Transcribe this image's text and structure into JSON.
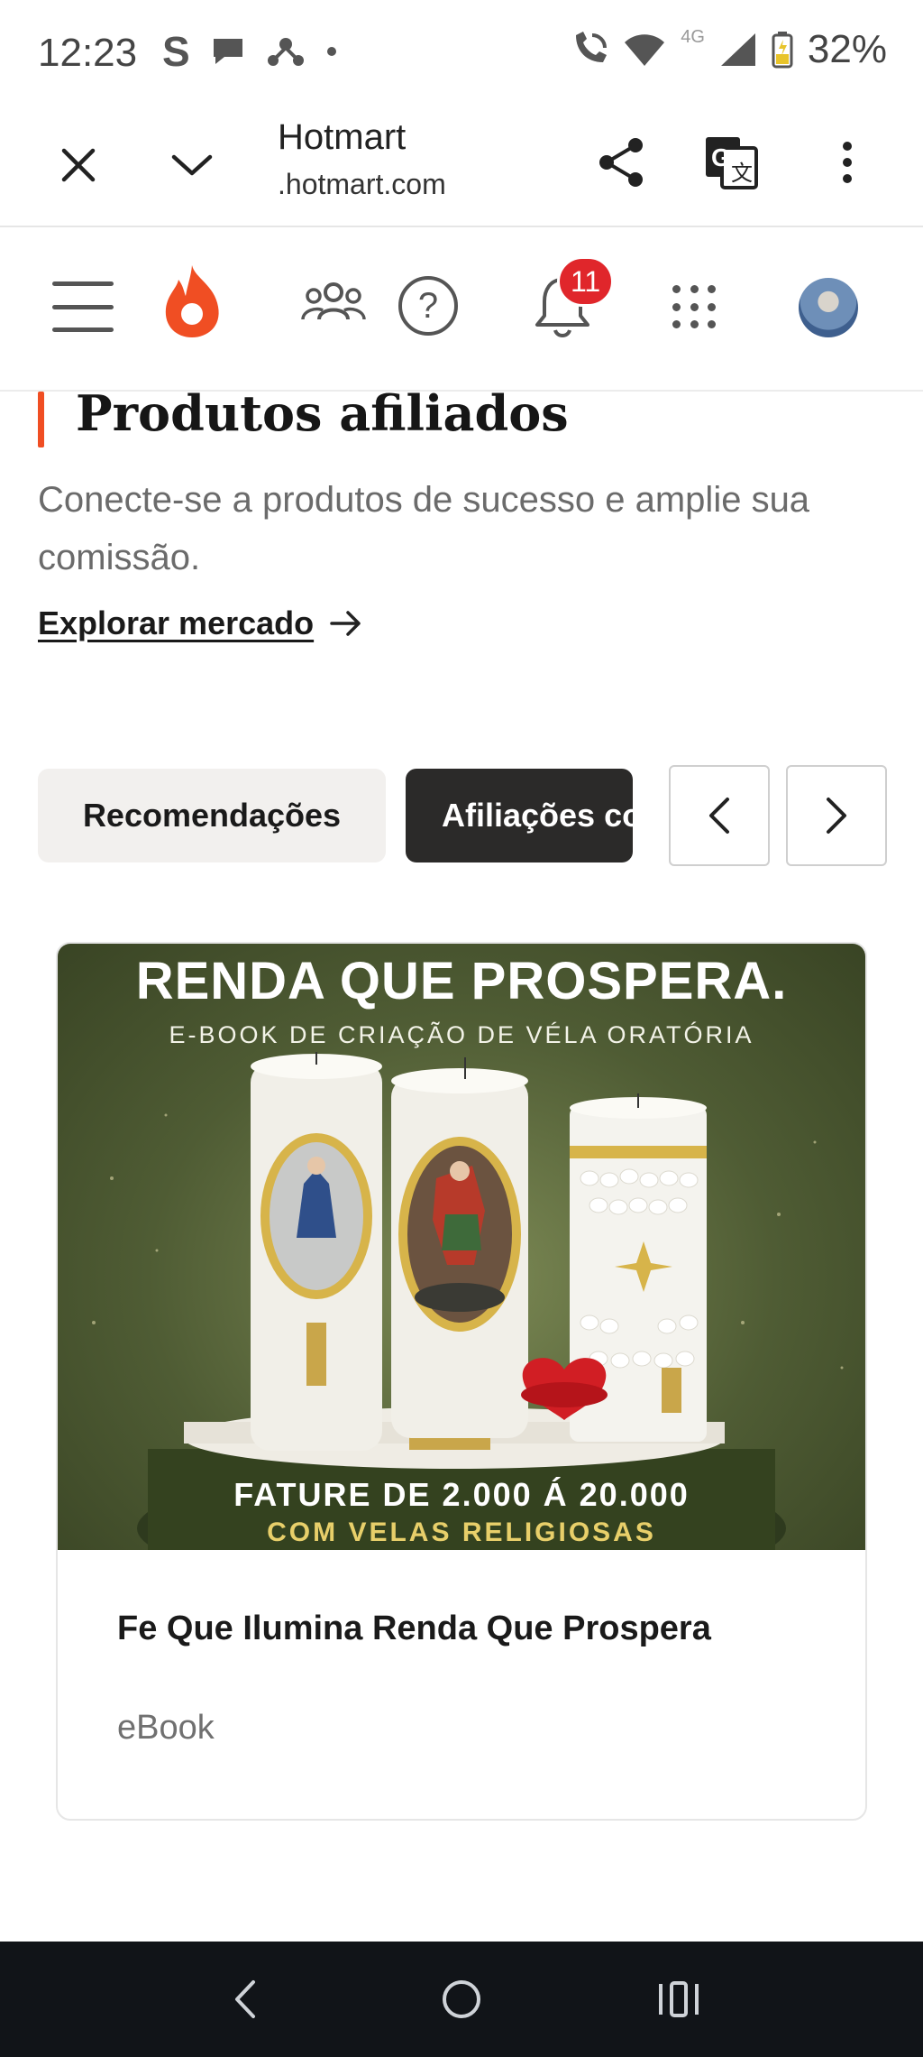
{
  "status_bar": {
    "time": "12:23",
    "network": "4G",
    "battery": "32%"
  },
  "tab_bar": {
    "title": "Hotmart",
    "url": ".hotmart.com"
  },
  "header": {
    "notifications_count": "11",
    "help_glyph": "?"
  },
  "section": {
    "title": "Produtos afiliados",
    "subtitle": "Conecte-se a produtos de sucesso e amplie sua comissão.",
    "explore_link": "Explorar mercado"
  },
  "chips": [
    {
      "label": "Recomendações",
      "active": false
    },
    {
      "label": "Afiliações com",
      "active": true
    }
  ],
  "product": {
    "image_headline": "RENDA QUE PROSPERA.",
    "image_subheadline": "E-BOOK DE CRIAÇÃO DE VÉLA ORATÓRIA",
    "image_bottom_line1": "FATURE DE 2.000 Á 20.000",
    "image_bottom_line2": "COM VELAS RELIGIOSAS",
    "name": "Fe Que Ilumina Renda Que Prospera",
    "type": "eBook"
  },
  "colors": {
    "brand_orange": "#f04e23",
    "badge_red": "#e0262b",
    "chip_dark": "#2b2a29",
    "chip_light": "#f2f0ee",
    "image_green": "#4f5c34",
    "gold_text": "#e8cf6a"
  },
  "icons": [
    "close-icon",
    "chevron-down-icon",
    "share-icon",
    "translate-icon",
    "more-vert-icon",
    "menu-icon",
    "hotmart-flame-logo",
    "people-icon",
    "help-icon",
    "bell-icon",
    "apps-grid-icon",
    "avatar",
    "arrow-right-icon",
    "chevron-left-icon",
    "chevron-right-icon",
    "back-icon",
    "home-icon",
    "recents-icon"
  ]
}
